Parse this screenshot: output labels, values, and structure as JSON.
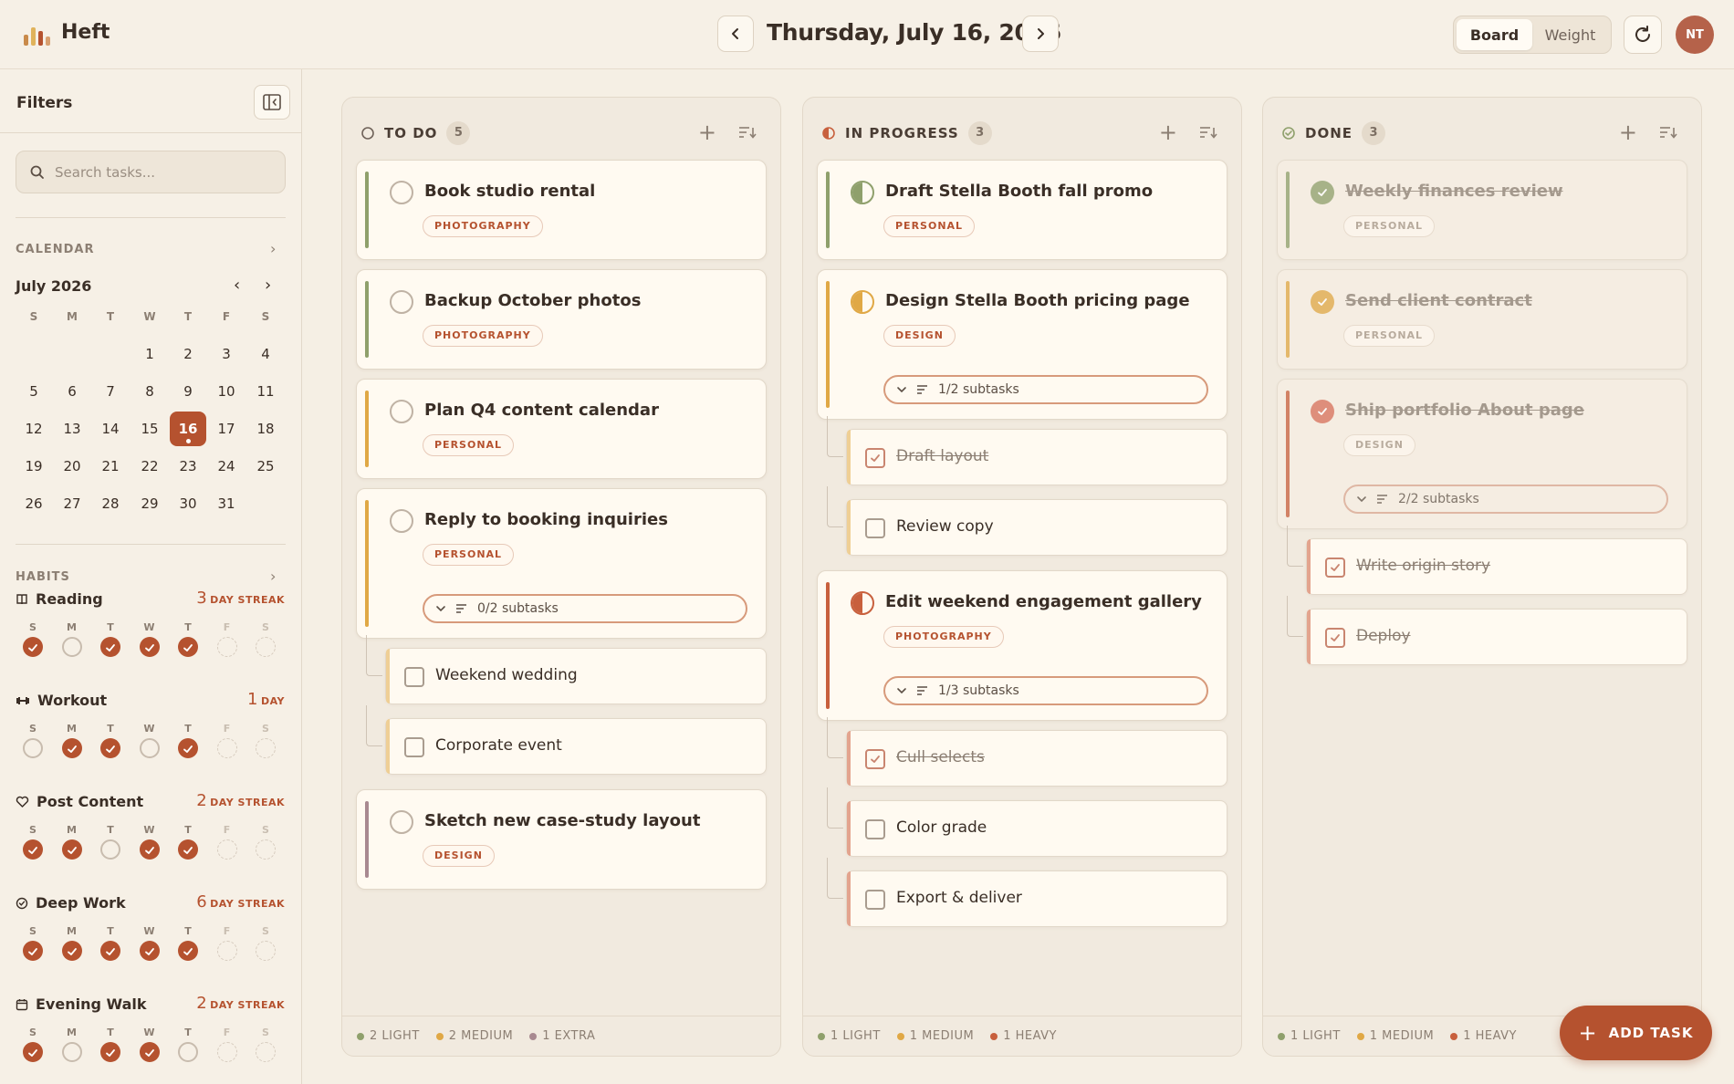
{
  "app": {
    "name": "Heft",
    "logo_colors": [
      "#c98a4a",
      "#e0b35b",
      "#b5522f",
      "#d8a070"
    ]
  },
  "header": {
    "date": "Thursday, July 16, 2026",
    "prev_icon": "chevron-left-icon",
    "next_icon": "chevron-right-icon",
    "views": [
      "Board",
      "Weight"
    ],
    "active_view": "Board",
    "refresh_icon": "refresh-icon",
    "avatar_initials": "NT"
  },
  "sidebar": {
    "filters_title": "Filters",
    "search_placeholder": "Search tasks...",
    "calendar_label": "CALENDAR",
    "month": "July 2026",
    "dow": [
      "S",
      "M",
      "T",
      "W",
      "T",
      "F",
      "S"
    ],
    "weeks": [
      [
        "",
        "",
        "",
        "1",
        "2",
        "3",
        "4"
      ],
      [
        "5",
        "6",
        "7",
        "8",
        "9",
        "10",
        "11"
      ],
      [
        "12",
        "13",
        "14",
        "15",
        "16",
        "17",
        "18"
      ],
      [
        "19",
        "20",
        "21",
        "22",
        "23",
        "24",
        "25"
      ],
      [
        "26",
        "27",
        "28",
        "29",
        "30",
        "31",
        ""
      ]
    ],
    "today": "16",
    "habits_label": "HABITS",
    "habits": [
      {
        "name": "Reading",
        "icon": "book-icon",
        "streak": "3",
        "streak_label": "DAY STREAK",
        "days": [
          "done",
          "miss",
          "done",
          "done",
          "done",
          "future",
          "future"
        ]
      },
      {
        "name": "Workout",
        "icon": "dumbbell-icon",
        "streak": "1",
        "streak_label": "DAY",
        "days": [
          "miss",
          "done",
          "done",
          "miss",
          "done",
          "future",
          "future"
        ]
      },
      {
        "name": "Post Content",
        "icon": "heart-icon",
        "streak": "2",
        "streak_label": "DAY STREAK",
        "days": [
          "done",
          "done",
          "miss",
          "done",
          "done",
          "future",
          "future"
        ]
      },
      {
        "name": "Deep Work",
        "icon": "check-circle-icon",
        "streak": "6",
        "streak_label": "DAY STREAK",
        "days": [
          "done",
          "done",
          "done",
          "done",
          "done",
          "future",
          "future"
        ]
      },
      {
        "name": "Evening Walk",
        "icon": "calendar-icon",
        "streak": "2",
        "streak_label": "DAY STREAK",
        "days": [
          "done",
          "miss",
          "done",
          "done",
          "miss",
          "future",
          "future"
        ]
      }
    ]
  },
  "colors": {
    "accent": "#b5522f",
    "light": "#8fa06c",
    "medium": "#e0a845",
    "heavy": "#c8603d",
    "extra": "#a88990"
  },
  "columns": [
    {
      "title": "TO DO",
      "count": "5",
      "footer": [
        {
          "label": "2 LIGHT",
          "color": "#8fa06c"
        },
        {
          "label": "2 MEDIUM",
          "color": "#e0a845"
        },
        {
          "label": "1 EXTRA",
          "color": "#a88990"
        }
      ],
      "cards": [
        {
          "title": "Book studio rental",
          "tag": "PHOTOGRAPHY"
        },
        {
          "title": "Backup October photos",
          "tag": "PHOTOGRAPHY"
        },
        {
          "title": "Plan Q4 content calendar",
          "tag": "PERSONAL"
        },
        {
          "title": "Reply to booking inquiries",
          "tag": "PERSONAL",
          "subtasks": "0/2 subtasks",
          "children": [
            "Weekend wedding",
            "Corporate event"
          ]
        },
        {
          "title": "Sketch new case-study layout",
          "tag": "DESIGN"
        }
      ]
    },
    {
      "title": "IN PROGRESS",
      "count": "3",
      "footer": [
        {
          "label": "1 LIGHT",
          "color": "#8fa06c"
        },
        {
          "label": "1 MEDIUM",
          "color": "#e0a845"
        },
        {
          "label": "1 HEAVY",
          "color": "#c8603d"
        }
      ],
      "cards": [
        {
          "title": "Draft Stella Booth fall promo",
          "tag": "PERSONAL"
        },
        {
          "title": "Design Stella Booth pricing page",
          "tag": "DESIGN",
          "subtasks": "1/2 subtasks",
          "children": [
            "Draft layout",
            "Review copy"
          ]
        },
        {
          "title": "Edit weekend engagement gallery",
          "tag": "PHOTOGRAPHY",
          "subtasks": "1/3 subtasks",
          "children": [
            "Cull selects",
            "Color grade",
            "Export & deliver"
          ]
        }
      ]
    },
    {
      "title": "DONE",
      "count": "3",
      "footer": [
        {
          "label": "1 LIGHT",
          "color": "#8fa06c"
        },
        {
          "label": "1 MEDIUM",
          "color": "#e0a845"
        },
        {
          "label": "1 HEAVY",
          "color": "#c8603d"
        }
      ],
      "cards": [
        {
          "title": "Weekly finances review",
          "tag": "PERSONAL"
        },
        {
          "title": "Send client contract",
          "tag": "PERSONAL"
        },
        {
          "title": "Ship portfolio About page",
          "tag": "DESIGN",
          "subtasks": "2/2 subtasks",
          "children": [
            "Write origin story",
            "Deploy"
          ]
        }
      ]
    }
  ],
  "add_task_label": "ADD TASK"
}
